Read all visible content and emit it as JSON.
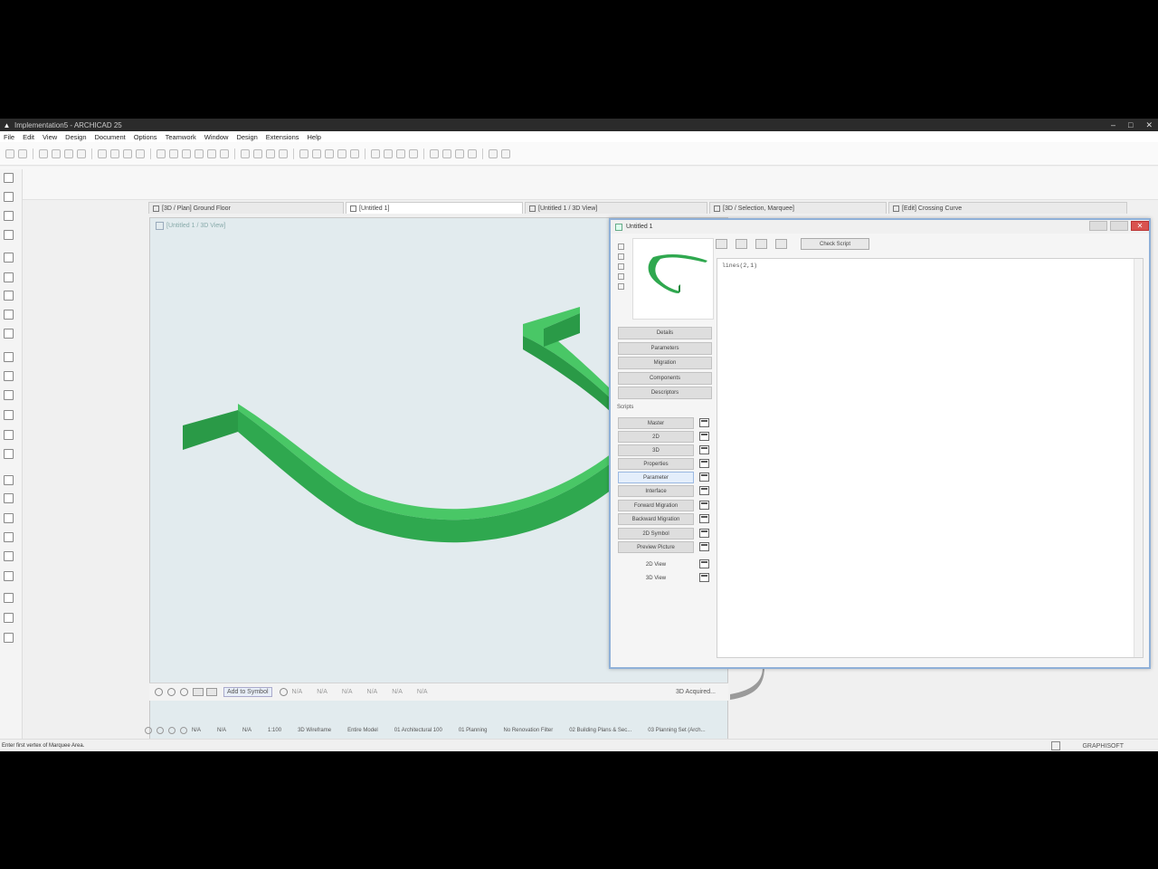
{
  "window": {
    "title": "Implementation5 - ARCHICAD 25"
  },
  "menu": [
    "File",
    "Edit",
    "View",
    "Design",
    "Document",
    "Options",
    "Teamwork",
    "Window",
    "Design",
    "Extensions",
    "Help"
  ],
  "tabs": [
    {
      "label": "[3D / Plan] Ground Floor"
    },
    {
      "label": "[Untitled 1]"
    },
    {
      "label": "[Untitled 1 / 3D View]"
    },
    {
      "label": "[3D / Selection, Marquee]"
    },
    {
      "label": "[Edit] Crossing Curve"
    }
  ],
  "viewport": {
    "header": "[Untitled 1 / 3D View]"
  },
  "navbar": {
    "add_to_symbol": "Add to Symbol",
    "fields": [
      "N/A",
      "N/A",
      "N/A",
      "N/A",
      "N/A",
      "N/A"
    ],
    "last": "3D Acquired..."
  },
  "gdl": {
    "title": "Untitled 1",
    "check_script": "Check Script",
    "code": "lines(2,1)",
    "nav_buttons": [
      "Details",
      "Parameters",
      "Migration",
      "Components",
      "Descriptors"
    ],
    "scripts_label": "Scripts",
    "scripts": [
      "Master",
      "2D",
      "3D",
      "Properties",
      "Parameter",
      "Interface",
      "Forward Migration",
      "Backward Migration",
      "2D Symbol",
      "Preview Picture"
    ],
    "views": [
      "2D View",
      "3D View"
    ]
  },
  "bottombar": {
    "items": [
      "N/A",
      "N/A",
      "N/A",
      "1:100",
      "3D Wireframe",
      "Entire Model",
      "01 Architectural 100",
      "01 Planning",
      "No Renovation Filter",
      "02 Building Plans & Sec...",
      "03 Planning Set (Arch..."
    ]
  },
  "status": {
    "message": "Enter first vertex of Marquee Area.",
    "brand": "GRAPHISOFT"
  },
  "colors": {
    "model_front": "#2fa84f",
    "model_top": "#43c15f",
    "model_side": "#22883d",
    "viewport_bg": "#e2ebee",
    "dialog_border": "#8fb0d8"
  }
}
